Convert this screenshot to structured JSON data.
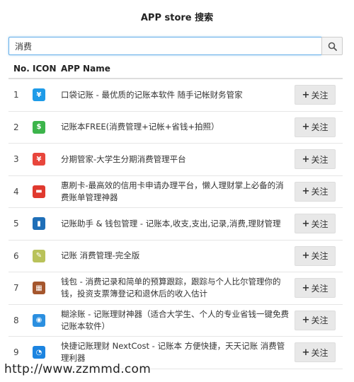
{
  "page": {
    "title": "APP store 搜索"
  },
  "search": {
    "value": "消费",
    "button_icon": "search-icon"
  },
  "table": {
    "headers": {
      "no": "No.",
      "icon": "ICON",
      "name": "APP Name"
    },
    "follow_label": "关注",
    "rows": [
      {
        "no": "1",
        "name": "口袋记账 - 最优质的记账本软件 随手记帐财务管家",
        "icon_color": "#1e9be8",
        "icon_glyph": "¥"
      },
      {
        "no": "2",
        "name": "记账本FREE(消费管理+记帐+省钱+拍照）",
        "icon_color": "#3cb44b",
        "icon_glyph": "$"
      },
      {
        "no": "3",
        "name": "分期管家-大学生分期消费管理平台",
        "icon_color": "#e8463c",
        "icon_glyph": "¥"
      },
      {
        "no": "4",
        "name": "惠刷卡-最高效的信用卡申请办理平台，懒人理财掌上必备的消费账单管理神器",
        "icon_color": "#e0392e",
        "icon_glyph": "▬"
      },
      {
        "no": "5",
        "name": "记账助手 & 钱包管理 - 记账本,收支,支出,记录,消费,理财管理",
        "icon_color": "#1f6fb8",
        "icon_glyph": "▮"
      },
      {
        "no": "6",
        "name": "记账 消费管理-完全版",
        "icon_color": "#b9c25a",
        "icon_glyph": "✎"
      },
      {
        "no": "7",
        "name": "钱包 - 消费记录和简单的预算跟踪，跟踪与个人比尔管理你的钱，投资支票簿登记和退休后的收入估计",
        "icon_color": "#a5562d",
        "icon_glyph": "▦"
      },
      {
        "no": "8",
        "name": "糊涂账 - 记账理财神器（适合大学生、个人的专业省钱一键免费记账本软件）",
        "icon_color": "#2b8fe0",
        "icon_glyph": "◉"
      },
      {
        "no": "9",
        "name": "快捷记账理财 NextCost - 记账本 方便快捷，天天记账 消费管理利器",
        "icon_color": "#1c84e0",
        "icon_glyph": "◔"
      }
    ]
  },
  "watermark": "http://www.zzmmd.com"
}
